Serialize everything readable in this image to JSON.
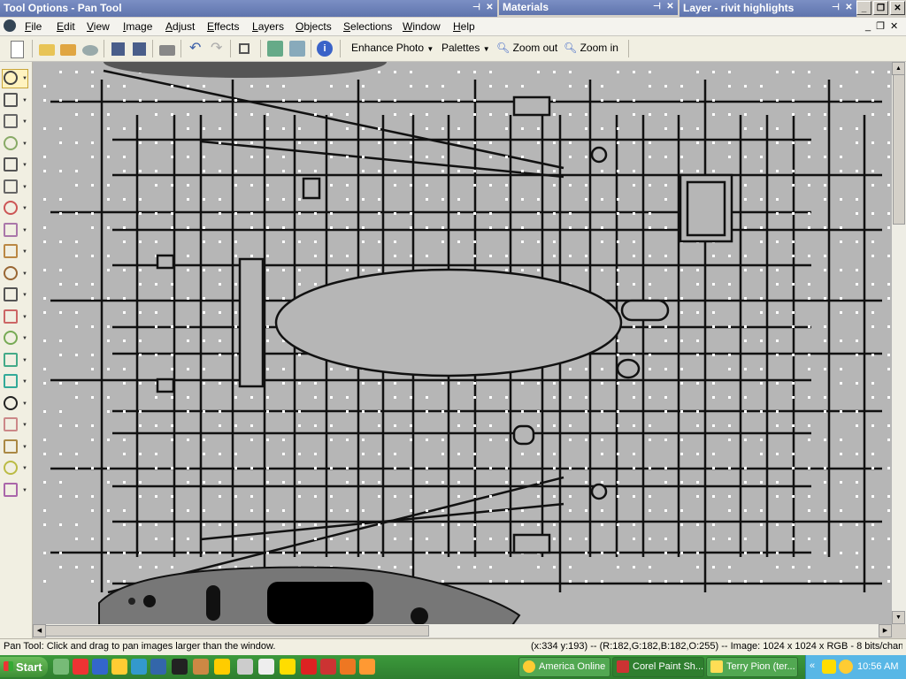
{
  "palettes": {
    "tool_options": "Tool Options - Pan Tool",
    "materials": "Materials",
    "layer": "Layer - rivit highlights"
  },
  "menu": [
    "File",
    "Edit",
    "View",
    "Image",
    "Adjust",
    "Effects",
    "Layers",
    "Objects",
    "Selections",
    "Window",
    "Help"
  ],
  "toolbar": {
    "enhance_photo": "Enhance Photo",
    "palettes": "Palettes",
    "zoom_out": "Zoom out",
    "zoom_in": "Zoom in"
  },
  "status": {
    "hint": "Pan Tool: Click and drag to pan images larger than the window.",
    "info": "(x:334 y:193) -- (R:182,G:182,B:182,O:255) -- Image:  1024 x 1024 x RGB - 8 bits/channel"
  },
  "taskbar": {
    "start": "Start",
    "tasks": [
      "America  Online",
      "Corel Paint Sh...",
      "Terry Pion (ter..."
    ],
    "clock": "10:56 AM"
  },
  "icons": {
    "tools": [
      "pan-tool-icon",
      "move-tool-icon",
      "selection-tool-icon",
      "dropper-icon",
      "crop-icon",
      "straighten-icon",
      "red-eye-icon",
      "clone-brush-icon",
      "scratch-remover-icon",
      "paint-brush-icon",
      "ellipse-tool-icon",
      "eraser-icon",
      "color-replacer-icon",
      "warp-brush-icon",
      "picture-tube-icon",
      "text-tool-icon",
      "preset-shape-icon",
      "pen-tool-icon",
      "lighten-brush-icon",
      "flood-fill-icon"
    ]
  },
  "colors": {
    "title_bar": "#6a7fb8",
    "canvas": "#b6b6b6",
    "taskbar": "#3a953a"
  }
}
